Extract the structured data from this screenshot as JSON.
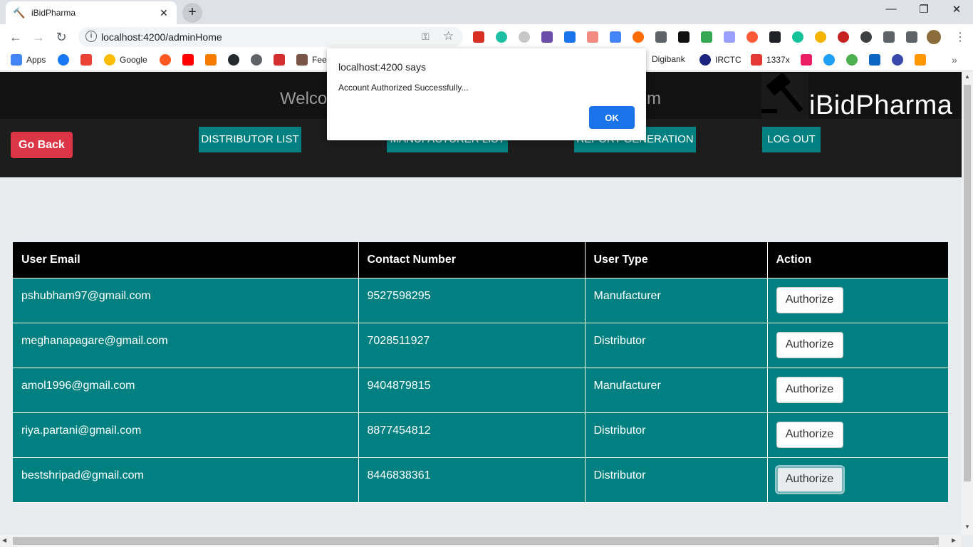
{
  "browser": {
    "tab_title": "iBidPharma",
    "url": "localhost:4200/adminHome",
    "bookmarks": [
      {
        "label": "Apps"
      },
      {
        "label": ""
      },
      {
        "label": ""
      },
      {
        "label": "Google"
      },
      {
        "label": "Fee"
      },
      {
        "label": "Digibank"
      },
      {
        "label": "IRCTC"
      },
      {
        "label": "1337x"
      }
    ],
    "bookmark_overflow": "»"
  },
  "header": {
    "welcome_text": "Welco",
    "welcome_suffix": "m",
    "logo_text": "iBidPharma",
    "go_back_label": "Go Back",
    "nav": [
      {
        "label": "DISTRIBUTOR LIST"
      },
      {
        "label": "MANUFACTURER LIST"
      },
      {
        "label": "REPORT GENERATION"
      },
      {
        "label": "LOG OUT"
      }
    ]
  },
  "table": {
    "columns": [
      "User Email",
      "Contact Number",
      "User Type",
      "Action"
    ],
    "rows": [
      {
        "email": "pshubham97@gmail.com",
        "contact": "9527598295",
        "type": "Manufacturer",
        "action": "Authorize"
      },
      {
        "email": "meghanapagare@gmail.com",
        "contact": "7028511927",
        "type": "Distributor",
        "action": "Authorize"
      },
      {
        "email": "amol1996@gmail.com",
        "contact": "9404879815",
        "type": "Manufacturer",
        "action": "Authorize"
      },
      {
        "email": "riya.partani@gmail.com",
        "contact": "8877454812",
        "type": "Distributor",
        "action": "Authorize"
      },
      {
        "email": "bestshripad@gmail.com",
        "contact": "8446838361",
        "type": "Distributor",
        "action": "Authorize"
      }
    ]
  },
  "dialog": {
    "title": "localhost:4200 says",
    "message": "Account Authorized Successfully...",
    "ok_label": "OK"
  },
  "colors": {
    "teal": "#008080",
    "danger": "#dc3545",
    "dialog_button": "#1a73e8"
  }
}
